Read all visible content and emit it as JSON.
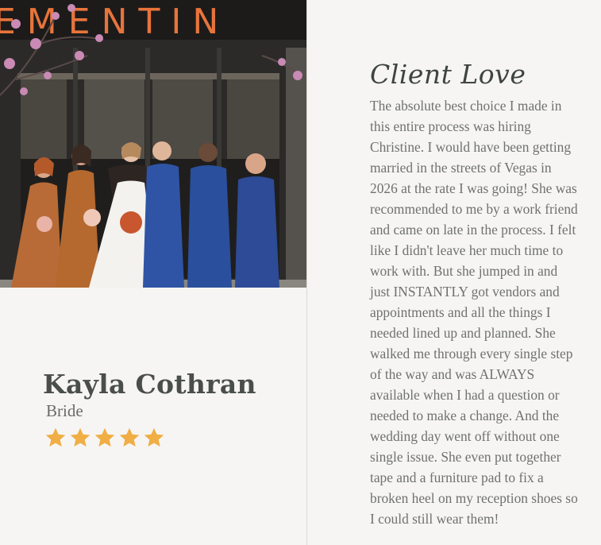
{
  "sign": {
    "text": "EMENTIN"
  },
  "client": {
    "name": "Kayla Cothran",
    "role": "Bride",
    "rating": 5
  },
  "section": {
    "heading": "Client Love"
  },
  "testimonial": {
    "text": "The absolute best choice I made in this entire process was hiring Christine. I would have been getting married in the streets of Vegas in 2026 at the rate I was going! She was recommended to me by a work friend and came on late in the process. I felt like I didn't leave her much time to work with. But she jumped in and just INSTANTLY got vendors and appointments and all the things I needed lined up and planned. She walked me through every single step of the way and was ALWAYS available when I had a question or needed to make a change. And the wedding day went off without one single issue. She even put together tape and a furniture pad to fix a broken heel on my reception shoes so I could still wear them!"
  },
  "colors": {
    "background": "#f6f5f3",
    "star": "#f0ae45",
    "name": "#4a4e4b",
    "body_text": "#6f7170",
    "sign_neon": "#e8743b"
  }
}
